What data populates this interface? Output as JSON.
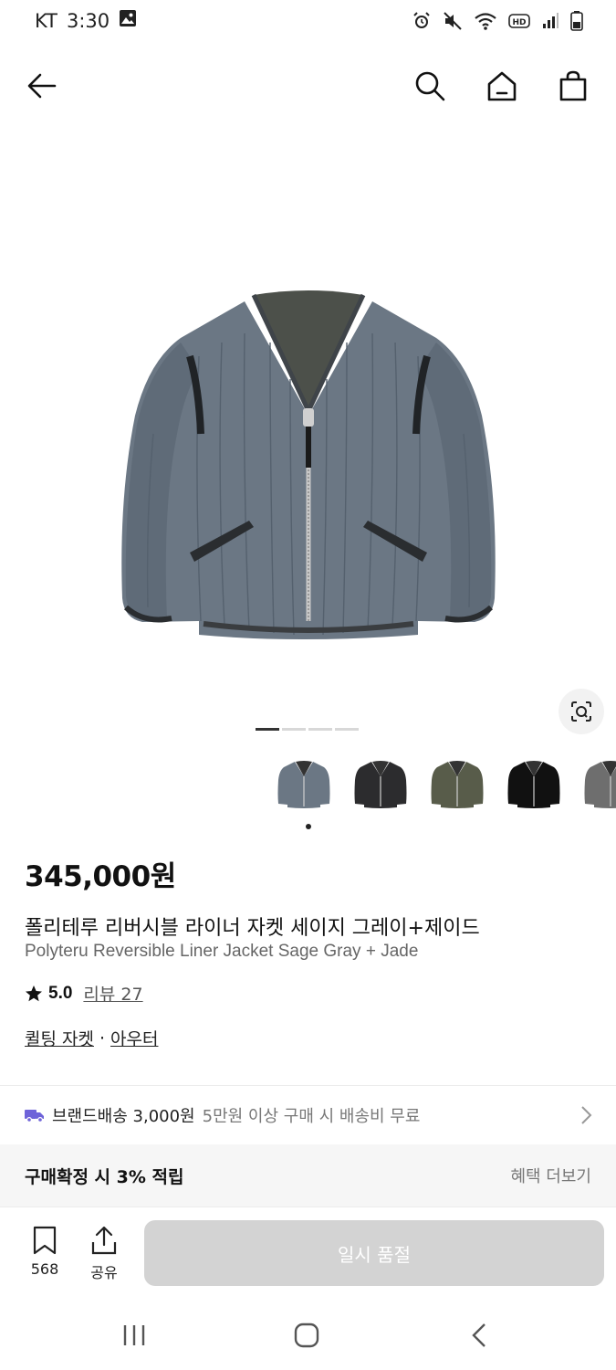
{
  "status_bar": {
    "carrier": "KT",
    "time": "3:30"
  },
  "product": {
    "price": "345,000원",
    "title_ko": "폴리테루 리버시블 라이너 자켓 세이지 그레이+제이드",
    "title_en": "Polyteru Reversible Liner Jacket Sage Gray + Jade",
    "rating": "5.0",
    "review_label": "리뷰 27",
    "categories": [
      "퀼팅 자켓",
      "아우터"
    ],
    "category_separator": "·"
  },
  "thumbnails": [
    {
      "color": "#6b7784",
      "name": "sage-gray"
    },
    {
      "color": "#2c2c2e",
      "name": "charcoal"
    },
    {
      "color": "#585c4a",
      "name": "olive"
    },
    {
      "color": "#111111",
      "name": "black"
    },
    {
      "color": "#6e6e6e",
      "name": "gray"
    }
  ],
  "shipping": {
    "brand": "브랜드배송 3,000원",
    "condition": "5만원 이상 구매 시 배송비 무료"
  },
  "points": {
    "text": "구매확정 시 3% 적립",
    "more": "혜택 더보기"
  },
  "actions": {
    "bookmark_count": "568",
    "share_label": "공유",
    "soldout_label": "일시 품절"
  },
  "colors": {
    "jacket": "#6a7683",
    "soldout_bg": "#d3d3d3",
    "shipping_truck": "#6e63d9"
  }
}
